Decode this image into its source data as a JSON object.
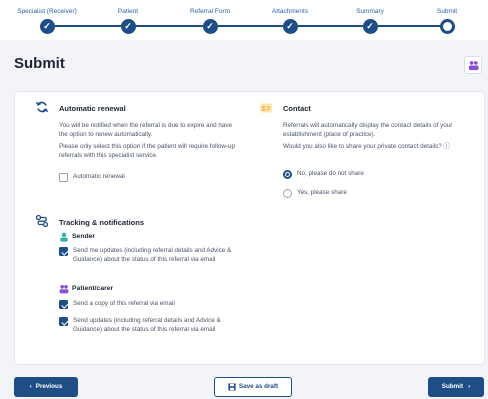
{
  "stepper": {
    "steps": [
      {
        "label": "Specialist (Receiver)",
        "state": "done",
        "icon": "check-icon"
      },
      {
        "label": "Patient",
        "state": "done",
        "icon": "check-icon"
      },
      {
        "label": "Referral Form",
        "state": "done",
        "icon": "check-icon"
      },
      {
        "label": "Attachments",
        "state": "done",
        "icon": "check-icon"
      },
      {
        "label": "Summary",
        "state": "done",
        "icon": "check-icon"
      },
      {
        "label": "Submit",
        "state": "current",
        "icon": "current-step-circle"
      }
    ],
    "check_glyph": "✓"
  },
  "header": {
    "title": "Submit",
    "team_icon": "people-icon"
  },
  "renewal": {
    "title": "Automatic renewal",
    "icon": "refresh-icon",
    "text1": "You will be notified when the referral is due to expire and have the option to renew automatically.",
    "text2": "Please only select this option if the patient will require follow-up referrals with this specialist service.",
    "checkbox_label": "Automatic renewal",
    "checked": false
  },
  "contact": {
    "title": "Contact",
    "icon": "contact-card-icon",
    "text1": "Referrals will automatically display the contact details of your establishment (place of practice).",
    "question": "Would you also like to share your private contact details?",
    "info_icon": "info-icon",
    "info_glyph": "ⓘ",
    "options": [
      {
        "label": "No, please do not share",
        "selected": true
      },
      {
        "label": "Yes, please share",
        "selected": false
      }
    ]
  },
  "tracking": {
    "title": "Tracking & notifications",
    "icon": "route-icon",
    "sender": {
      "title": "Sender",
      "icon": "user-icon",
      "options": [
        {
          "label": "Send me updates (including referral details and Advice & Guidance) about the status of this referral via email",
          "checked": true
        }
      ]
    },
    "patient": {
      "title": "Patient/carer",
      "icon": "people-icon",
      "options": [
        {
          "label": "Send a copy of this referral via email",
          "checked": true
        },
        {
          "label": "Send updates (including referral details and Advice & Guidance) about the status of this referral via email",
          "checked": true
        }
      ]
    }
  },
  "footer": {
    "previous": "Previous",
    "previous_glyph": "‹",
    "save_draft": "Save as draft",
    "save_icon": "save-icon",
    "submit": "Submit",
    "submit_glyph": "›"
  },
  "colors": {
    "primary": "#1f4e86",
    "step_label": "#2d64a6",
    "sender_icon": "#2bb3a8",
    "patient_icon": "#8a4fd6",
    "contact_icon": "#f0b340",
    "background": "#f3f4f7"
  }
}
